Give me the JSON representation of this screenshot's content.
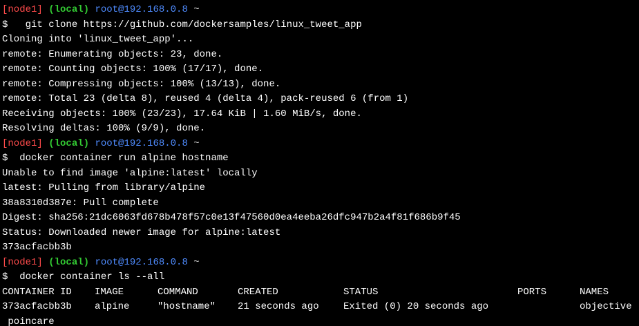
{
  "prompt": {
    "node": "[node1]",
    "local": "(local)",
    "host": "root@192.168.0.8",
    "tilde": "~"
  },
  "colors": {
    "background": "#000000",
    "text": "#ffffff",
    "node": "#ff4b4b",
    "local": "#33cc33",
    "host": "#4f8cff"
  },
  "block1": {
    "command": "$   git clone https://github.com/dockersamples/linux_tweet_app",
    "output": [
      "Cloning into 'linux_tweet_app'...",
      "remote: Enumerating objects: 23, done.",
      "remote: Counting objects: 100% (17/17), done.",
      "remote: Compressing objects: 100% (13/13), done.",
      "remote: Total 23 (delta 8), reused 4 (delta 4), pack-reused 6 (from 1)",
      "Receiving objects: 100% (23/23), 17.64 KiB | 1.60 MiB/s, done.",
      "Resolving deltas: 100% (9/9), done."
    ]
  },
  "block2": {
    "command": "$  docker container run alpine hostname",
    "output": [
      "Unable to find image 'alpine:latest' locally",
      "latest: Pulling from library/alpine",
      "38a8310d387e: Pull complete",
      "Digest: sha256:21dc6063fd678b478f57c0e13f47560d0ea4eeba26dfc947b2a4f81f686b9f45",
      "Status: Downloaded newer image for alpine:latest",
      "373acfacbb3b"
    ]
  },
  "block3": {
    "command": "$  docker container ls --all",
    "table": {
      "headers": {
        "container_id": "CONTAINER ID",
        "image": "IMAGE",
        "command": "COMMAND",
        "created": "CREATED",
        "status": "STATUS",
        "ports": "PORTS",
        "names": "NAMES"
      },
      "row": {
        "container_id": "373acfacbb3b",
        "image": "alpine",
        "command": "\"hostname\"",
        "created": "21 seconds ago",
        "status": "Exited (0) 20 seconds ago",
        "ports": "",
        "names": "objective"
      },
      "wrap": " poincare"
    }
  }
}
